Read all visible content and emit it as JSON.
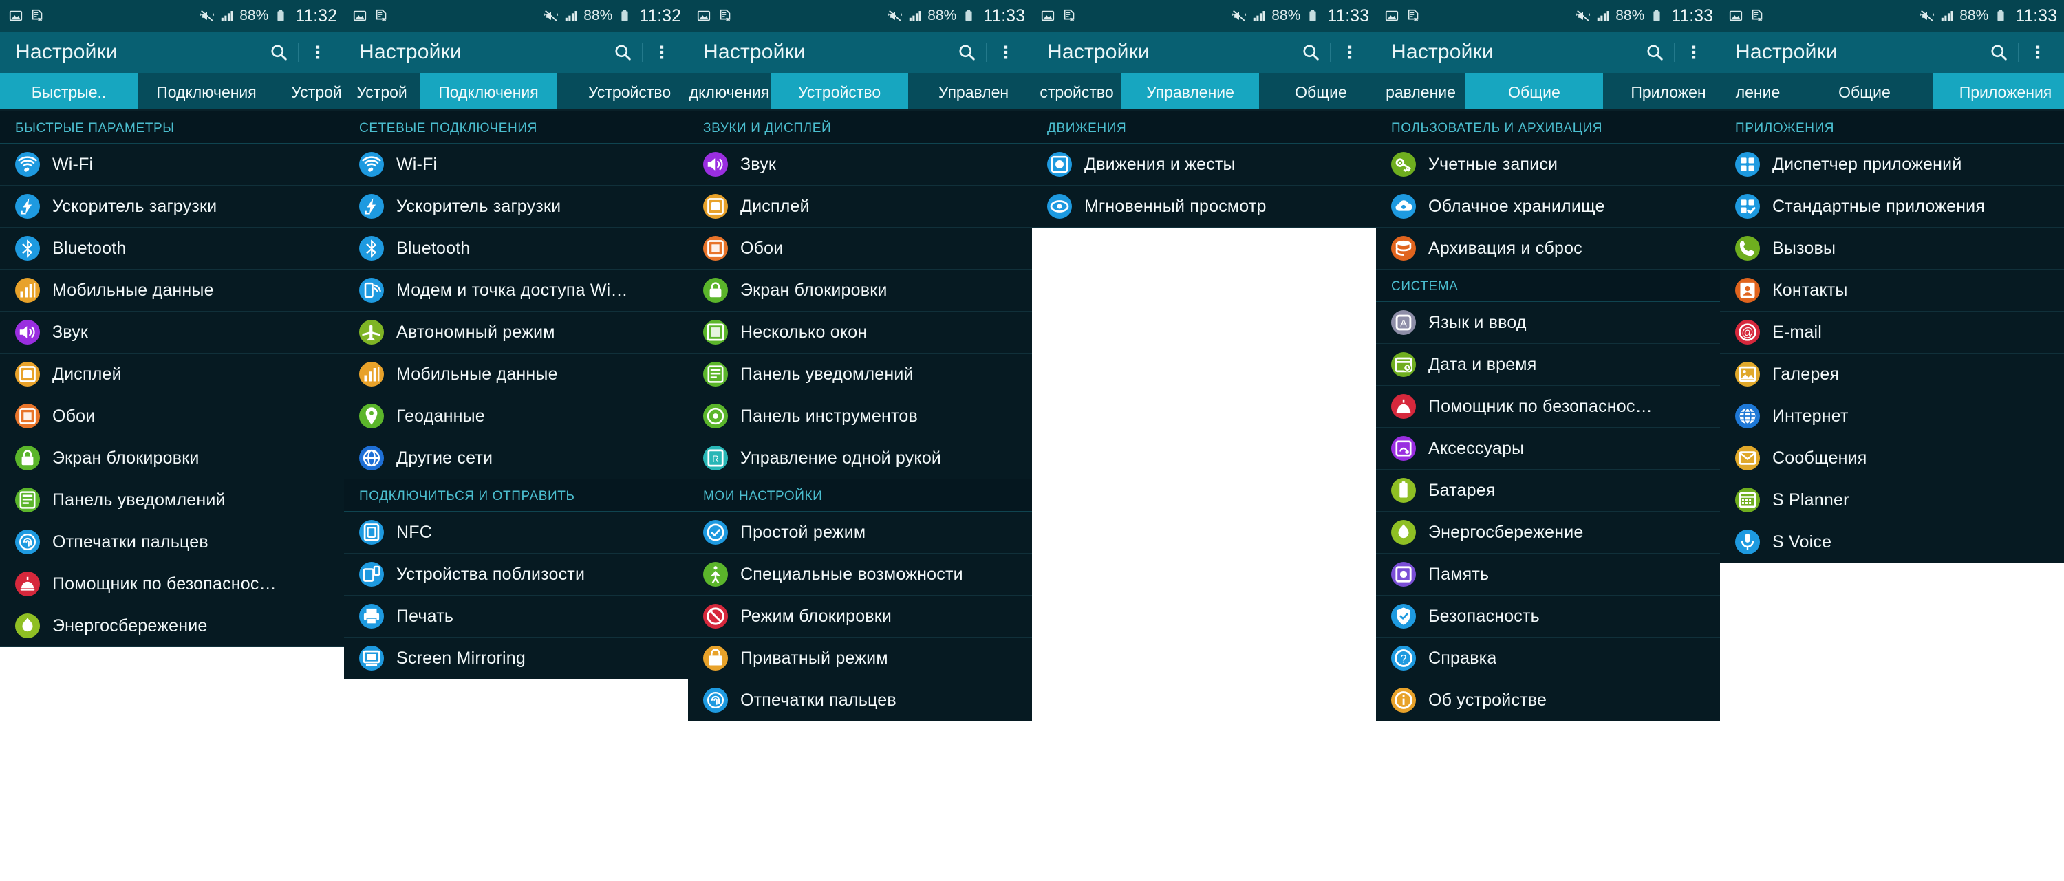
{
  "statusbar": {
    "battery_percent": "88%",
    "icons": [
      "image-icon",
      "document-error-icon",
      "mute-vibrate-icon",
      "signal-bars-icon",
      "battery-icon"
    ],
    "times": [
      "11:32",
      "11:32",
      "11:33",
      "11:33",
      "11:33",
      "11:33"
    ]
  },
  "actionbar": {
    "title": "Настройки",
    "search_icon": "search-icon",
    "overflow_icon": "more-vertical-icon"
  },
  "panels": [
    {
      "id": "quick-settings",
      "time": "11:32",
      "tabs": [
        {
          "label": "Быстрые..",
          "active": true
        },
        {
          "label": "Подключения",
          "active": false
        },
        {
          "label": "Устрой",
          "active": false
        }
      ],
      "sections": [
        {
          "header": "БЫСТРЫЕ ПАРАМЕТРЫ",
          "items": [
            {
              "label": "Wi-Fi",
              "icon": "wifi-icon",
              "color": "#1e9ae0"
            },
            {
              "label": "Ускоритель загрузки",
              "icon": "download-booster-icon",
              "color": "#1e9ae0"
            },
            {
              "label": "Bluetooth",
              "icon": "bluetooth-icon",
              "color": "#1e9ae0"
            },
            {
              "label": "Мобильные данные",
              "icon": "mobile-data-icon",
              "color": "#e8a22a"
            },
            {
              "label": "Звук",
              "icon": "sound-icon",
              "color": "#9a2ee0"
            },
            {
              "label": "Дисплей",
              "icon": "display-icon",
              "color": "#e8a22a"
            },
            {
              "label": "Обои",
              "icon": "wallpaper-icon",
              "color": "#e8742a"
            },
            {
              "label": "Экран блокировки",
              "icon": "lock-screen-icon",
              "color": "#5bb52b"
            },
            {
              "label": "Панель уведомлений",
              "icon": "notification-panel-icon",
              "color": "#5bb52b"
            },
            {
              "label": "Отпечатки пальцев",
              "icon": "fingerprint-icon",
              "color": "#1e9ae0"
            },
            {
              "label": "Помощник по безопаснос…",
              "icon": "safety-assistance-icon",
              "color": "#d6283c"
            },
            {
              "label": "Энергосбережение",
              "icon": "power-saving-icon",
              "color": "#8fbf24"
            }
          ]
        }
      ]
    },
    {
      "id": "connections",
      "time": "11:32",
      "tabs": [
        {
          "label": "Устрой",
          "active": false
        },
        {
          "label": "Подключения",
          "active": true
        },
        {
          "label": "Устройство",
          "active": false
        }
      ],
      "sections": [
        {
          "header": "СЕТЕВЫЕ ПОДКЛЮЧЕНИЯ",
          "items": [
            {
              "label": "Wi-Fi",
              "icon": "wifi-icon",
              "color": "#1e9ae0"
            },
            {
              "label": "Ускоритель загрузки",
              "icon": "download-booster-icon",
              "color": "#1e9ae0"
            },
            {
              "label": "Bluetooth",
              "icon": "bluetooth-icon",
              "color": "#1e9ae0"
            },
            {
              "label": "Модем и точка доступа Wi…",
              "icon": "tethering-icon",
              "color": "#1e9ae0"
            },
            {
              "label": "Автономный режим",
              "icon": "airplane-mode-icon",
              "color": "#7fb525"
            },
            {
              "label": "Мобильные данные",
              "icon": "mobile-data-icon",
              "color": "#e8a22a"
            },
            {
              "label": "Геоданные",
              "icon": "location-icon",
              "color": "#5bb52b"
            },
            {
              "label": "Другие сети",
              "icon": "other-networks-icon",
              "color": "#1e6fd6"
            }
          ]
        },
        {
          "header": "ПОДКЛЮЧИТЬСЯ И ОТПРАВИТЬ",
          "items": [
            {
              "label": "NFC",
              "icon": "nfc-icon",
              "color": "#1e9ae0"
            },
            {
              "label": "Устройства поблизости",
              "icon": "nearby-devices-icon",
              "color": "#1e9ae0"
            },
            {
              "label": "Печать",
              "icon": "print-icon",
              "color": "#1e9ae0"
            },
            {
              "label": "Screen Mirroring",
              "icon": "screen-mirroring-icon",
              "color": "#1e9ae0"
            }
          ]
        }
      ]
    },
    {
      "id": "device",
      "time": "11:33",
      "tabs": [
        {
          "label": "дключения",
          "active": false
        },
        {
          "label": "Устройство",
          "active": true
        },
        {
          "label": "Управлен",
          "active": false
        }
      ],
      "sections": [
        {
          "header": "ЗВУКИ И ДИСПЛЕЙ",
          "items": [
            {
              "label": "Звук",
              "icon": "sound-icon",
              "color": "#9a2ee0"
            },
            {
              "label": "Дисплей",
              "icon": "display-icon",
              "color": "#e8a22a"
            },
            {
              "label": "Обои",
              "icon": "wallpaper-icon",
              "color": "#e8742a"
            },
            {
              "label": "Экран блокировки",
              "icon": "lock-screen-icon",
              "color": "#5bb52b"
            },
            {
              "label": "Несколько окон",
              "icon": "multi-window-icon",
              "color": "#5bb52b"
            },
            {
              "label": "Панель уведомлений",
              "icon": "notification-panel-icon",
              "color": "#5bb52b"
            },
            {
              "label": "Панель инструментов",
              "icon": "toolbox-icon",
              "color": "#5bb52b"
            },
            {
              "label": "Управление одной рукой",
              "icon": "one-handed-icon",
              "color": "#28b6b6"
            }
          ]
        },
        {
          "header": "МОИ НАСТРОЙКИ",
          "items": [
            {
              "label": "Простой режим",
              "icon": "easy-mode-icon",
              "color": "#1e9ae0"
            },
            {
              "label": "Специальные возможности",
              "icon": "accessibility-icon",
              "color": "#5bb52b"
            },
            {
              "label": "Режим блокировки",
              "icon": "blocking-mode-icon",
              "color": "#d6283c"
            },
            {
              "label": "Приватный режим",
              "icon": "private-mode-icon",
              "color": "#e8a22a"
            },
            {
              "label": "Отпечатки пальцев",
              "icon": "fingerprint-icon",
              "color": "#1e9ae0"
            }
          ]
        }
      ]
    },
    {
      "id": "controls",
      "time": "11:33",
      "tabs": [
        {
          "label": "стройство",
          "active": false
        },
        {
          "label": "Управление",
          "active": true
        },
        {
          "label": "Общие",
          "active": false
        }
      ],
      "sections": [
        {
          "header": "ДВИЖЕНИЯ",
          "items": [
            {
              "label": "Движения и жесты",
              "icon": "motions-gestures-icon",
              "color": "#1e9ae0"
            },
            {
              "label": "Мгновенный просмотр",
              "icon": "air-view-icon",
              "color": "#1e9ae0"
            }
          ]
        }
      ]
    },
    {
      "id": "general",
      "time": "11:33",
      "tabs": [
        {
          "label": "равление",
          "active": false
        },
        {
          "label": "Общие",
          "active": true
        },
        {
          "label": "Приложен",
          "active": false
        }
      ],
      "sections": [
        {
          "header": "ПОЛЬЗОВАТЕЛЬ И АРХИВАЦИЯ",
          "items": [
            {
              "label": "Учетные записи",
              "icon": "accounts-key-icon",
              "color": "#6fae1f"
            },
            {
              "label": "Облачное хранилище",
              "icon": "cloud-icon",
              "color": "#1e9ae0"
            },
            {
              "label": "Архивация и сброс",
              "icon": "backup-reset-icon",
              "color": "#e0641e"
            }
          ]
        },
        {
          "header": "СИСТЕМА",
          "items": [
            {
              "label": "Язык и ввод",
              "icon": "language-input-icon",
              "color": "#8e8ea8"
            },
            {
              "label": "Дата и время",
              "icon": "date-time-icon",
              "color": "#6fae1f"
            },
            {
              "label": "Помощник по безопаснос…",
              "icon": "safety-assistance-icon",
              "color": "#d6283c"
            },
            {
              "label": "Аксессуары",
              "icon": "accessories-icon",
              "color": "#9a2ee0"
            },
            {
              "label": "Батарея",
              "icon": "battery-icon",
              "color": "#8fbf24"
            },
            {
              "label": "Энергосбережение",
              "icon": "power-saving-icon",
              "color": "#8fbf24"
            },
            {
              "label": "Память",
              "icon": "storage-icon",
              "color": "#7a4ed6"
            },
            {
              "label": "Безопасность",
              "icon": "security-icon",
              "color": "#1e9ae0"
            },
            {
              "label": "Справка",
              "icon": "help-icon",
              "color": "#1e9ae0"
            },
            {
              "label": "Об устройстве",
              "icon": "about-device-icon",
              "color": "#e8a22a"
            }
          ]
        }
      ]
    },
    {
      "id": "applications",
      "time": "11:33",
      "tabs": [
        {
          "label": "ление",
          "active": false
        },
        {
          "label": "Общие",
          "active": false
        },
        {
          "label": "Приложения",
          "active": true
        }
      ],
      "sections": [
        {
          "header": "ПРИЛОЖЕНИЯ",
          "items": [
            {
              "label": "Диспетчер приложений",
              "icon": "app-manager-icon",
              "color": "#1e9ae0"
            },
            {
              "label": "Стандартные приложения",
              "icon": "default-apps-icon",
              "color": "#1e9ae0"
            },
            {
              "label": "Вызовы",
              "icon": "phone-icon",
              "color": "#6fae1f"
            },
            {
              "label": "Контакты",
              "icon": "contacts-icon",
              "color": "#e0641e"
            },
            {
              "label": "E-mail",
              "icon": "email-icon",
              "color": "#d6283c"
            },
            {
              "label": "Галерея",
              "icon": "gallery-icon",
              "color": "#e0a82a"
            },
            {
              "label": "Интернет",
              "icon": "internet-globe-icon",
              "color": "#1e78d6"
            },
            {
              "label": "Сообщения",
              "icon": "messages-icon",
              "color": "#e0a82a"
            },
            {
              "label": "S Planner",
              "icon": "s-planner-icon",
              "color": "#6fae1f"
            },
            {
              "label": "S Voice",
              "icon": "s-voice-icon",
              "color": "#1e9ae0"
            }
          ]
        }
      ]
    }
  ]
}
